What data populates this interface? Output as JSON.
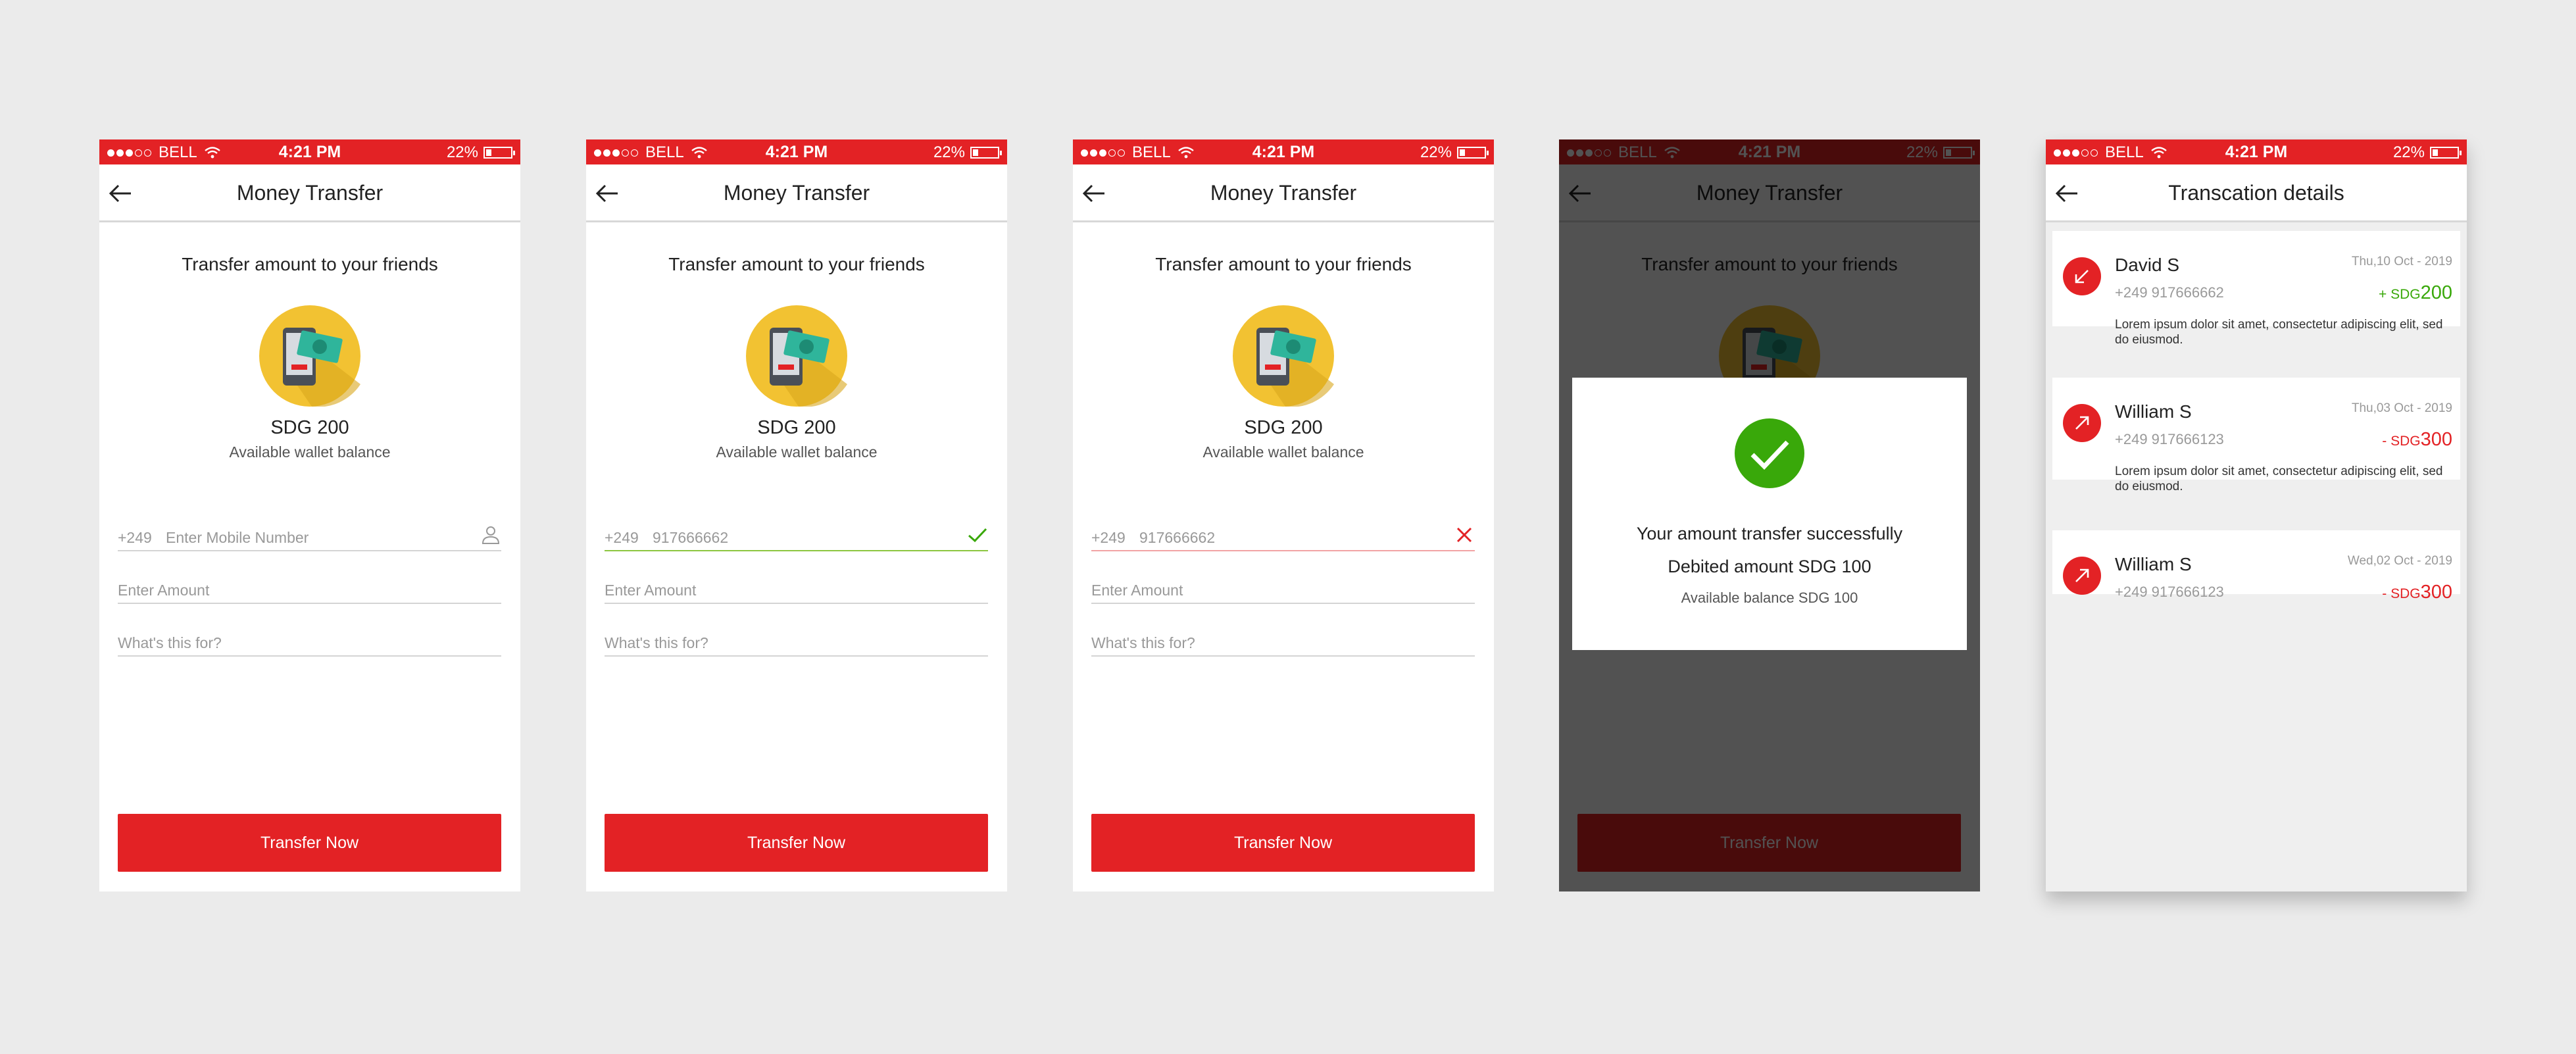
{
  "status_bar": {
    "carrier": "BELL",
    "time": "4:21 PM",
    "battery": "22%"
  },
  "transfer": {
    "title": "Money Transfer",
    "subtitle": "Transfer amount to your friends",
    "balance": "SDG 200",
    "balance_label": "Available wallet balance",
    "country_code": "+249",
    "mobile_placeholder": "Enter Mobile Number",
    "mobile_value": "917666662",
    "amount_placeholder": "Enter Amount",
    "purpose_placeholder": "What's this for?",
    "button_label": "Transfer Now"
  },
  "success_dialog": {
    "line1": "Your amount transfer successfully",
    "line2": "Debited amount SDG 100",
    "line3": "Available balance SDG 100"
  },
  "transactions": {
    "title": "Transcation details",
    "items": [
      {
        "name": "David S",
        "phone": "+249   917666662",
        "date": "Thu,10 Oct - 2019",
        "sign": "+ SDG",
        "amount": "200",
        "type": "credit",
        "desc": "Lorem ipsum dolor sit amet, consectetur adipiscing elit, sed do eiusmod."
      },
      {
        "name": "William S",
        "phone": "+249   917666123",
        "date": "Thu,03 Oct - 2019",
        "sign": "- SDG",
        "amount": "300",
        "type": "debit",
        "desc": "Lorem ipsum dolor sit amet, consectetur adipiscing elit, sed do eiusmod."
      },
      {
        "name": "William S",
        "phone": "+249   917666123",
        "date": "Wed,02 Oct - 2019",
        "sign": "- SDG",
        "amount": "300",
        "type": "debit"
      }
    ]
  },
  "colors": {
    "brand_red": "#e32225",
    "success_green": "#39a80a",
    "valid_green": "#8cc63f"
  },
  "icons": [
    "back-arrow-icon",
    "wifi-icon",
    "battery-icon",
    "wallet-phone-cash-icon",
    "contact-icon",
    "checkmark-icon",
    "cross-icon",
    "success-check-icon",
    "incoming-arrow-icon",
    "outgoing-arrow-icon"
  ]
}
